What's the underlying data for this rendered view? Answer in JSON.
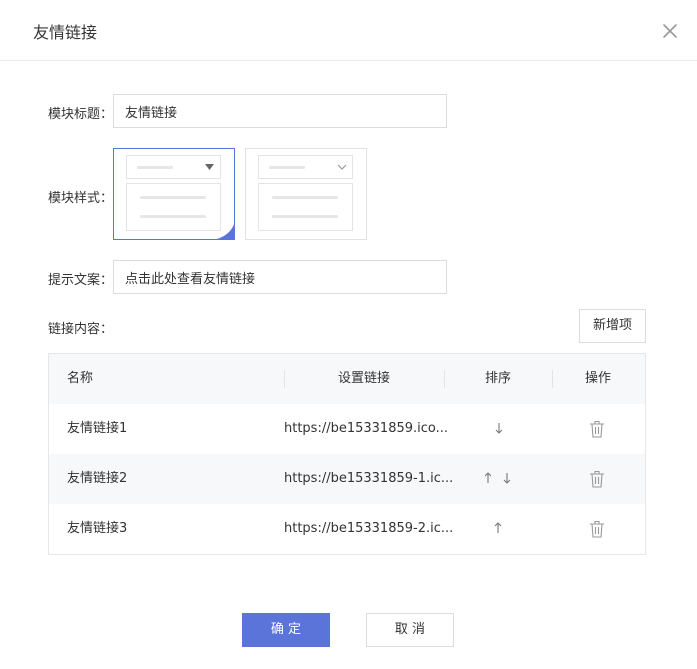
{
  "dialog": {
    "title": "友情链接"
  },
  "form": {
    "module_title": {
      "label": "模块标题：",
      "value": "友情链接"
    },
    "module_style": {
      "label": "模块样式："
    },
    "hint_text": {
      "label": "提示文案：",
      "value": "点击此处查看友情链接"
    },
    "link_content": {
      "label": "链接内容："
    }
  },
  "toolbar": {
    "add_label": "新增项"
  },
  "table": {
    "columns": [
      "名称",
      "设置链接",
      "排序",
      "操作"
    ],
    "rows": [
      {
        "name": "友情链接1",
        "url": "https://be15331859.ico...",
        "sort": [
          "down"
        ]
      },
      {
        "name": "友情链接2",
        "url": "https://be15331859-1.ic...",
        "sort": [
          "up",
          "down"
        ]
      },
      {
        "name": "友情链接3",
        "url": "https://be15331859-2.ic...",
        "sort": [
          "up"
        ]
      }
    ]
  },
  "footer": {
    "confirm_label": "确 定",
    "cancel_label": "取 消"
  },
  "colors": {
    "primary": "#5b74d9",
    "header_bg": "#f7f8fa",
    "border": "#dcdcdc",
    "icon": "#999999"
  },
  "icons": [
    "close-icon",
    "checkmark-icon",
    "arrow-up-icon",
    "arrow-down-icon",
    "trash-icon",
    "caret-down-icon",
    "chevron-down-icon"
  ]
}
